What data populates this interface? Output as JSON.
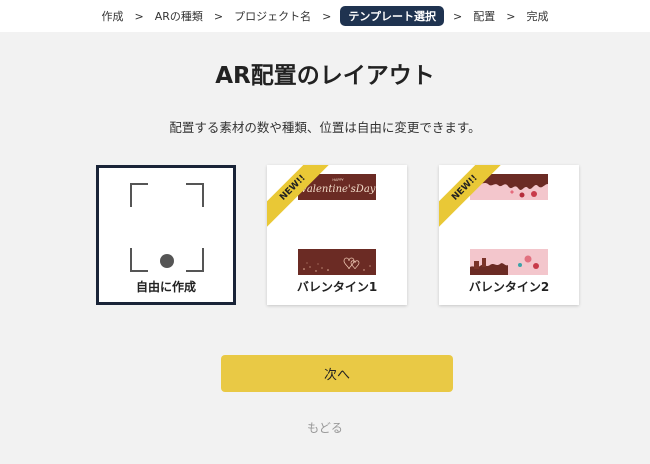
{
  "breadcrumb": {
    "steps": [
      "作成",
      "ARの種類",
      "プロジェクト名",
      "テンプレート選択",
      "配置",
      "完成"
    ],
    "separator": ">"
  },
  "page_title": "AR配置のレイアウト",
  "subtitle": "配置する素材の数や種類、位置は自由に変更できます。",
  "templates": [
    {
      "label": "自由に作成",
      "badge": ""
    },
    {
      "label": "バレンタイン1",
      "badge": "NEW!!",
      "banner_text": "Valentine'sDay"
    },
    {
      "label": "バレンタイン2",
      "badge": "NEW!!"
    }
  ],
  "next_button": "次へ",
  "back_link": "もどる",
  "colors": {
    "accent": "#e9c945",
    "active_step": "#1f3350",
    "chocolate": "#6b2b24",
    "pink": "#f3c6cc"
  }
}
